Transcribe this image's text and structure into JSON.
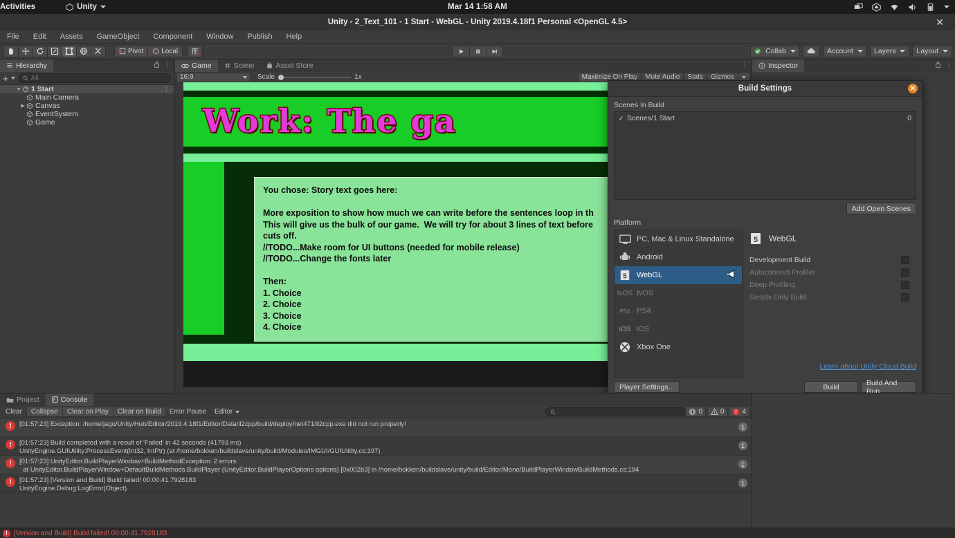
{
  "os_bar": {
    "activities": "Activities",
    "app_name": "Unity",
    "clock": "Mar 14  1:58 AM",
    "tray_icons": [
      "screencast-icon",
      "unity-icon",
      "wifi-icon",
      "volume-icon",
      "battery-icon",
      "caret-down-icon"
    ]
  },
  "window": {
    "title": "Unity - 2_Text_101 - 1 Start - WebGL - Unity 2019.4.18f1 Personal <OpenGL 4.5>",
    "close_label": "✕"
  },
  "menubar": {
    "items": [
      "File",
      "Edit",
      "Assets",
      "GameObject",
      "Component",
      "Window",
      "Publish",
      "Help"
    ]
  },
  "toolbar": {
    "tools": [
      "hand-tool-icon",
      "move-tool-icon",
      "rotate-tool-icon",
      "scale-tool-icon",
      "rect-tool-icon",
      "transform-tool-icon",
      "custom-tool-icon"
    ],
    "pivot_label": "Pivot",
    "local_label": "Local",
    "snap_icon": "snap-grid-icon",
    "play_label": "▶",
    "pause_label": "❙❙",
    "step_label": "▶❙",
    "collab_label": "Collab",
    "cloud_icon": "cloud-icon",
    "account_label": "Account",
    "layers_label": "Layers",
    "layout_label": "Layout"
  },
  "hierarchy": {
    "tab_label": "Hierarchy",
    "lock_icon": "lock-icon",
    "menu_icon": "kebab-menu-icon",
    "add_label": "+",
    "search_placeholder": "All",
    "items": [
      {
        "label": "1 Start",
        "depth": 0,
        "twisty": "▼",
        "selected": true,
        "icon": "scene-icon"
      },
      {
        "label": "Main Camera",
        "depth": 1,
        "twisty": "",
        "selected": false,
        "icon": "gameobject-icon"
      },
      {
        "label": "Canvas",
        "depth": 1,
        "twisty": "▶",
        "selected": false,
        "icon": "gameobject-icon"
      },
      {
        "label": "EventSystem",
        "depth": 1,
        "twisty": "",
        "selected": false,
        "icon": "gameobject-icon"
      },
      {
        "label": "Game",
        "depth": 1,
        "twisty": "",
        "selected": false,
        "icon": "gameobject-icon"
      }
    ]
  },
  "gameview": {
    "tabs": [
      {
        "label": "Game",
        "icon": "game-icon",
        "selected": true
      },
      {
        "label": "Scene",
        "icon": "scene-grid-icon",
        "selected": false
      },
      {
        "label": "Asset Store",
        "icon": "store-icon",
        "selected": false
      }
    ],
    "menu_icon": "kebab-menu-icon",
    "aspect": "16:9",
    "scale_label": "Scale",
    "scale_value": "1x",
    "buttons": [
      "Maximize On Play",
      "Mute Audio",
      "Stats",
      "Gizmos"
    ],
    "game_title": "Work: The ga",
    "story_text": "You chose: Story text goes here:\n\nMore exposition to show how much we can write before the sentences loop in th\nThis will give us the bulk of our game.  We will try for about 3 lines of text before\ncuts off.\n//TODO...Make room for UI buttons (needed for mobile release)\n//TODO...Change the fonts later\n\nThen:\n1. Choice\n2. Choice\n3. Choice\n4. Choice",
    "colors": {
      "bright_green": "#18cd25",
      "light_green": "#76ef98",
      "dark_green": "#062d06",
      "panel_green": "#89e398",
      "title_magenta": "#e23bd8",
      "title_outline": "#8a0b0b"
    }
  },
  "inspector": {
    "tab_label": "Inspector",
    "info_icon": "info-icon",
    "lock_icon": "lock-icon",
    "menu_icon": "kebab-menu-icon"
  },
  "build_settings": {
    "title": "Build Settings",
    "close_label": "✕",
    "scenes_label": "Scenes In Build",
    "scenes": [
      {
        "checked": true,
        "name": "Scenes/1 Start",
        "index": "0"
      }
    ],
    "add_open_scenes_label": "Add Open Scenes",
    "platform_label": "Platform",
    "platforms": [
      {
        "label": "PC, Mac & Linux Standalone",
        "icon": "desktop-icon",
        "selected": false,
        "dim": false
      },
      {
        "label": "Android",
        "icon": "android-icon",
        "selected": false,
        "dim": false
      },
      {
        "label": "WebGL",
        "icon": "html5-icon",
        "selected": true,
        "dim": false
      },
      {
        "label": "tvOS",
        "icon": "tvos-icon",
        "selected": false,
        "dim": true
      },
      {
        "label": "PS4",
        "icon": "ps4-icon",
        "selected": false,
        "dim": true
      },
      {
        "label": "iOS",
        "icon": "ios-icon",
        "selected": false,
        "dim": true
      },
      {
        "label": "Xbox One",
        "icon": "xbox-icon",
        "selected": false,
        "dim": false
      }
    ],
    "selected_platform": "WebGL",
    "selected_platform_icon": "html5-icon",
    "options": [
      {
        "label": "Development Build",
        "checked": false,
        "dim": false
      },
      {
        "label": "Autoconnect Profiler",
        "checked": false,
        "dim": true
      },
      {
        "label": "Deep Profiling",
        "checked": false,
        "dim": true
      },
      {
        "label": "Scripts Only Build",
        "checked": false,
        "dim": true
      }
    ],
    "cloud_build_link": "Learn about Unity Cloud Build",
    "player_settings_label": "Player Settings...",
    "build_label": "Build",
    "build_and_run_label": "Build And Run"
  },
  "console": {
    "tabs": [
      {
        "label": "Project",
        "icon": "folder-icon",
        "selected": false
      },
      {
        "label": "Console",
        "icon": "console-icon",
        "selected": true
      }
    ],
    "buttons": [
      "Clear",
      "Collapse",
      "Clear on Play",
      "Clear on Build",
      "Error Pause",
      "Editor"
    ],
    "search_placeholder": "",
    "search_icon": "search-icon",
    "counts": {
      "info": "0",
      "warning": "0",
      "error": "4"
    },
    "messages": [
      {
        "line1": "[01:57:23] Exception: /home/jago/Unity/Hub/Editor/2019.4.18f1/Editor/Data/il2cpp/build/deploy/net471/il2cpp.exe did not run properly!",
        "line2": "",
        "badge": "1"
      },
      {
        "line1": "[01:57:23] Build completed with a result of 'Failed' in 42 seconds (41793 ms)",
        "line2": "UnityEngine.GUIUtility:ProcessEvent(Int32, IntPtr) (at /home/bokken/buildslave/unity/build/Modules/IMGUI/GUIUtility.cs:197)",
        "badge": "1"
      },
      {
        "line1": "[01:57:23] UnityEditor.BuildPlayerWindow+BuildMethodException: 2 errors",
        "line2": "  at UnityEditor.BuildPlayerWindow+DefaultBuildMethods.BuildPlayer (UnityEditor.BuildPlayerOptions options) [0x002b3] in /home/bokken/buildslave/unity/build/Editor/Mono/BuildPlayerWindowBuildMethods.cs:194",
        "badge": "1"
      },
      {
        "line1": "[01:57:23] [Version and Build] Build failed! 00:00:41.7928183",
        "line2": "UnityEngine.Debug:LogError(Object)",
        "badge": "1"
      }
    ]
  },
  "statusbar": {
    "icon": "error-icon",
    "text": "[Version and Build] Build failed! 00:00:41.7928183"
  }
}
